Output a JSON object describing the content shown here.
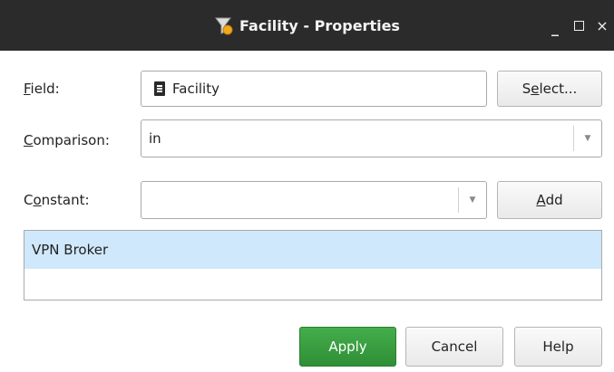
{
  "window": {
    "title": "Facility - Properties",
    "icon": "funnel-badge-icon",
    "controls": [
      "_",
      "□",
      "×"
    ]
  },
  "field": {
    "label_pre": "",
    "label_key": "F",
    "label_post": "ield:",
    "value": "Facility",
    "value_icon": "document-icon",
    "select_pre": "S",
    "select_key": "e",
    "select_post": "lect..."
  },
  "comparison": {
    "label_key": "C",
    "label_post": "omparison:",
    "value": "in"
  },
  "constant": {
    "label_pre": "C",
    "label_key": "o",
    "label_post": "nstant:",
    "value": "",
    "add_key": "A",
    "add_post": "dd"
  },
  "list": {
    "items": [
      "VPN Broker"
    ]
  },
  "buttons": {
    "apply": "Apply",
    "cancel": "Cancel",
    "help": "Help"
  },
  "colors": {
    "titlebar": "#2b2b2b",
    "apply": "#3a9e40",
    "selection": "#cfe8fb"
  }
}
